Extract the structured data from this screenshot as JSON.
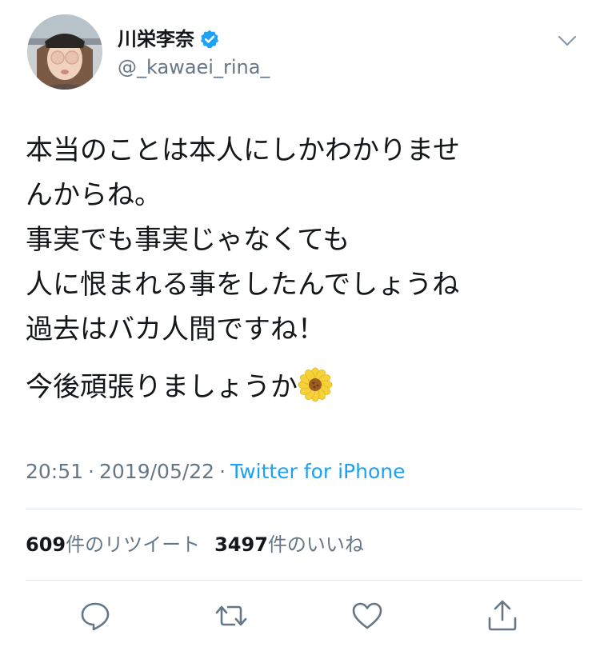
{
  "user": {
    "display_name": "川栄李奈",
    "handle": "@_kawaei_rina_",
    "verified": true,
    "avatar_icon": "profile-photo"
  },
  "tweet": {
    "lines": [
      "本当のことは本人にしかわかりませ",
      "んからね。",
      "事実でも事実じゃなくても",
      "人に恨まれる事をしたんでしょうね",
      "過去はバカ人間ですね！"
    ],
    "last_line": "今後頑張りましょうか",
    "emoji": "sunflower-emoji"
  },
  "meta": {
    "time": "20:51",
    "separator": "·",
    "date": "2019/05/22",
    "source": "Twitter for iPhone"
  },
  "stats": {
    "retweet_count": "609",
    "retweet_label": "件のリツイート",
    "like_count": "3497",
    "like_label": "件のいいね"
  },
  "icons": {
    "menu": "chevron-down-icon",
    "reply": "reply-icon",
    "retweet": "retweet-icon",
    "like": "heart-icon",
    "share": "share-icon"
  },
  "colors": {
    "text": "#14171a",
    "secondary": "#657786",
    "link": "#1da1f2",
    "verified": "#1da1f2",
    "divider": "#e1e8ed"
  }
}
